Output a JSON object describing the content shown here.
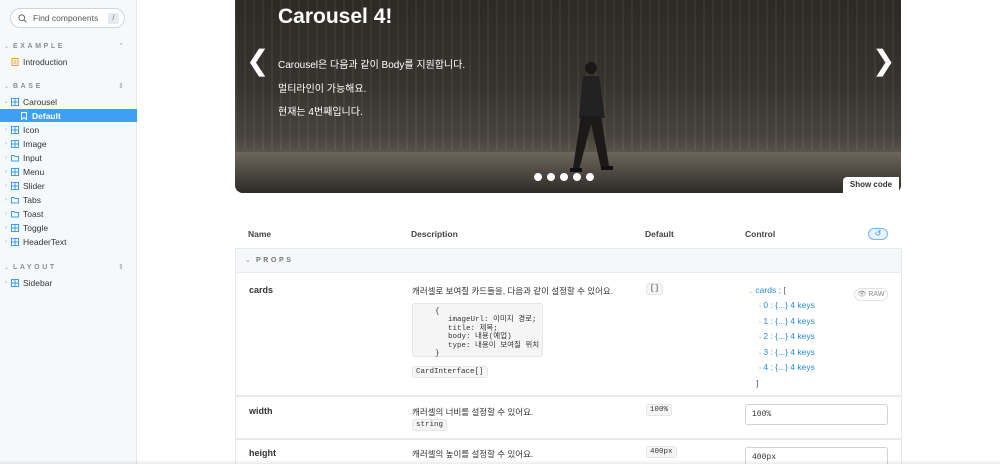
{
  "search": {
    "placeholder": "Find components",
    "shortcut": "/"
  },
  "sidebar": {
    "sections": [
      {
        "title": "EXAMPLE",
        "toggle": "⌃",
        "items": [
          {
            "label": "Introduction"
          }
        ]
      },
      {
        "title": "BASE",
        "toggle": "⌃⌄",
        "items": [
          {
            "label": "Carousel"
          },
          {
            "label": "Default"
          },
          {
            "label": "Icon"
          },
          {
            "label": "Image"
          },
          {
            "label": "Input"
          },
          {
            "label": "Menu"
          },
          {
            "label": "Slider"
          },
          {
            "label": "Tabs"
          },
          {
            "label": "Toast"
          },
          {
            "label": "Toggle"
          },
          {
            "label": "HeaderText"
          }
        ]
      },
      {
        "title": "LAYOUT",
        "toggle": "⌃⌄",
        "items": [
          {
            "label": "Sidebar"
          }
        ]
      }
    ],
    "selected": "Default"
  },
  "carousel": {
    "title": "Carousel 4!",
    "body": [
      "Carousel은 다음과 같이 Body를 지원합니다.",
      "멀티라인이 가능해요.",
      "현재는 4번째입니다."
    ],
    "prev_icon": "❮",
    "next_icon": "❯",
    "dot_count": 5,
    "show_code": "Show code"
  },
  "table": {
    "headers": {
      "name": "Name",
      "description": "Description",
      "default": "Default",
      "control": "Control"
    },
    "group_label": "PROPS",
    "rows": {
      "cards": {
        "name": "cards",
        "description": "캐러셀로 보여질 카드들을, 다음과 같이 설정할 수 있어요.",
        "code": [
          "{",
          "  imageUrl: 이미지 경로;",
          "  title: 제목;",
          "  body: 내용(예업)",
          "  type: 내용이 보여질 위치",
          "}"
        ],
        "type": "CardInterface[]",
        "default": "[]",
        "control": {
          "key": "cards",
          "open": "[",
          "close": "]",
          "items": [
            "0 : {...} 4 keys",
            "1 : {...} 4 keys",
            "2 : {...} 4 keys",
            "3 : {...} 4 keys",
            "4 : {...} 4 keys"
          ],
          "raw": "RAW"
        }
      },
      "width": {
        "name": "width",
        "description": "캐러셀의 너비를 설정할 수 있어요.",
        "type": "string",
        "default": "100%",
        "value": "100%"
      },
      "height": {
        "name": "height",
        "description": "캐러셀의 높이를 설정할 수 있어요.",
        "default": "400px",
        "value": "400px"
      }
    }
  }
}
